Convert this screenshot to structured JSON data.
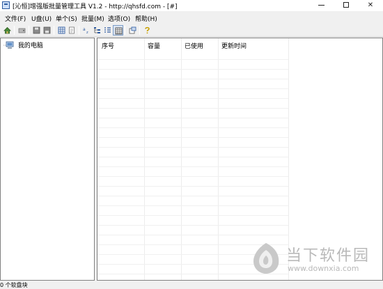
{
  "window": {
    "title": "[沁恒]增强版批量管理工具 V1.2 - http://qhsfd.com - [#]"
  },
  "menu": [
    {
      "label": "文件(F)"
    },
    {
      "label": "U盘(U)"
    },
    {
      "label": "单个(S)"
    },
    {
      "label": "批量(M)"
    },
    {
      "label": "选项(O)"
    },
    {
      "label": "帮助(H)"
    }
  ],
  "toolbar": {
    "icons": [
      "home-icon",
      "drive-icon",
      "save-icon",
      "save-as-icon",
      "grid-view-icon",
      "export-icon",
      "sort-icon",
      "tree-icon",
      "list-view-icon",
      "details-view-icon",
      "properties-icon",
      "help-icon"
    ],
    "pressed": "details-view-icon"
  },
  "tree": {
    "root_label": "我的电脑"
  },
  "list": {
    "columns": [
      "序号",
      "容量",
      "已使用",
      "更新时间"
    ],
    "rows": []
  },
  "status": {
    "text": "0 个软盘块"
  },
  "watermark": {
    "name": "当下软件园",
    "url": "www.downxia.com"
  },
  "colors": {
    "accent": "#2c5aa0",
    "window_bg": "#f0f0f0",
    "panel_bg": "#ffffff"
  }
}
